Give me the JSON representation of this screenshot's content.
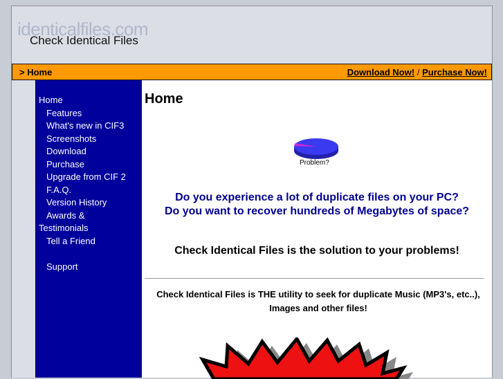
{
  "header": {
    "logo_text": "identicalfiles.com",
    "site_title": "Check Identical Files"
  },
  "bar": {
    "breadcrumb": "> Home",
    "download_link": "Download Now!",
    "separator": "/",
    "purchase_link": "Purchase Now!"
  },
  "nav": {
    "items": [
      {
        "label": "Home"
      },
      {
        "label": "Features"
      },
      {
        "label": "What's new in CIF3"
      },
      {
        "label": "Screenshots"
      },
      {
        "label": "Download"
      },
      {
        "label": "Purchase"
      },
      {
        "label": "Upgrade from CIF 2"
      },
      {
        "label": "F.A.Q."
      },
      {
        "label": "Version History"
      },
      {
        "label": "Awards &"
      },
      {
        "label": "Testimonials"
      },
      {
        "label": "Tell a Friend"
      },
      {
        "label": "Support"
      }
    ]
  },
  "content": {
    "heading": "Home",
    "pie_label": "Problem?",
    "question_1": "Do you experience a lot of duplicate files on your PC?",
    "question_2": "Do you want to recover hundreds of Megabytes of space?",
    "solution": "Check Identical Files is the solution to your problems!",
    "utility_line_1": "Check Identical Files is THE utility to seek for duplicate Music (MP3's, etc..),",
    "utility_line_2": "Images and other files!"
  },
  "colors": {
    "bar": "#ff9900",
    "sidebar": "#00009c",
    "question_text": "#00008f",
    "burst_fill": "#ee1111"
  }
}
